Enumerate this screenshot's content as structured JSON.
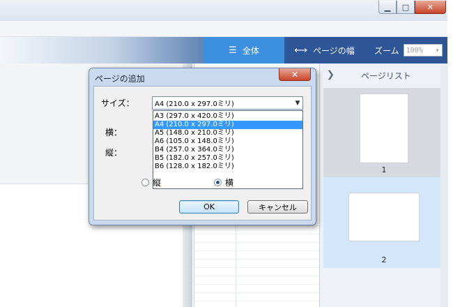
{
  "window": {
    "minimize_glyph": "▁",
    "maximize_glyph": "□",
    "close_glyph": "✕"
  },
  "toolbar": {
    "view_all_label": "全体",
    "page_width_label": "ページの幅",
    "zoom_label": "ズーム",
    "zoom_value": "100%",
    "zoom_arrow": "▾",
    "view_all_icon": "☰",
    "page_width_icon": "⟷",
    "accent_color": "#3d8fe0",
    "ribbon_color": "#2e5596"
  },
  "page_list": {
    "title": "ページリスト",
    "toggle_glyph": "❯",
    "pages": [
      {
        "number": "1",
        "orientation": "portrait"
      },
      {
        "number": "2",
        "orientation": "landscape"
      }
    ],
    "selected_page": "2"
  },
  "dialog": {
    "title": "ページの追加",
    "close_glyph": "✕",
    "size_label": "サイズ：",
    "size_value": "A4 (210.0 x 297.0ミリ)",
    "dropdown_arrow": "▼",
    "width_label": "横：",
    "height_label": "縦：",
    "size_options": [
      "A3 (297.0 x 420.0ミリ)",
      "A4 (210.0 x 297.0ミリ)",
      "A5 (148.0 x 210.0ミリ)",
      "A6 (105.0 x 148.0ミリ)",
      "B4 (257.0 x 364.0ミリ)",
      "B5 (182.0 x 257.0ミリ)",
      "B6 (128.0 x 182.0ミリ)"
    ],
    "selected_option_index": 1,
    "orientation_portrait": "縦",
    "orientation_landscape": "横",
    "orientation_selected": "横",
    "ok_label": "OK",
    "cancel_label": "キャンセル"
  }
}
